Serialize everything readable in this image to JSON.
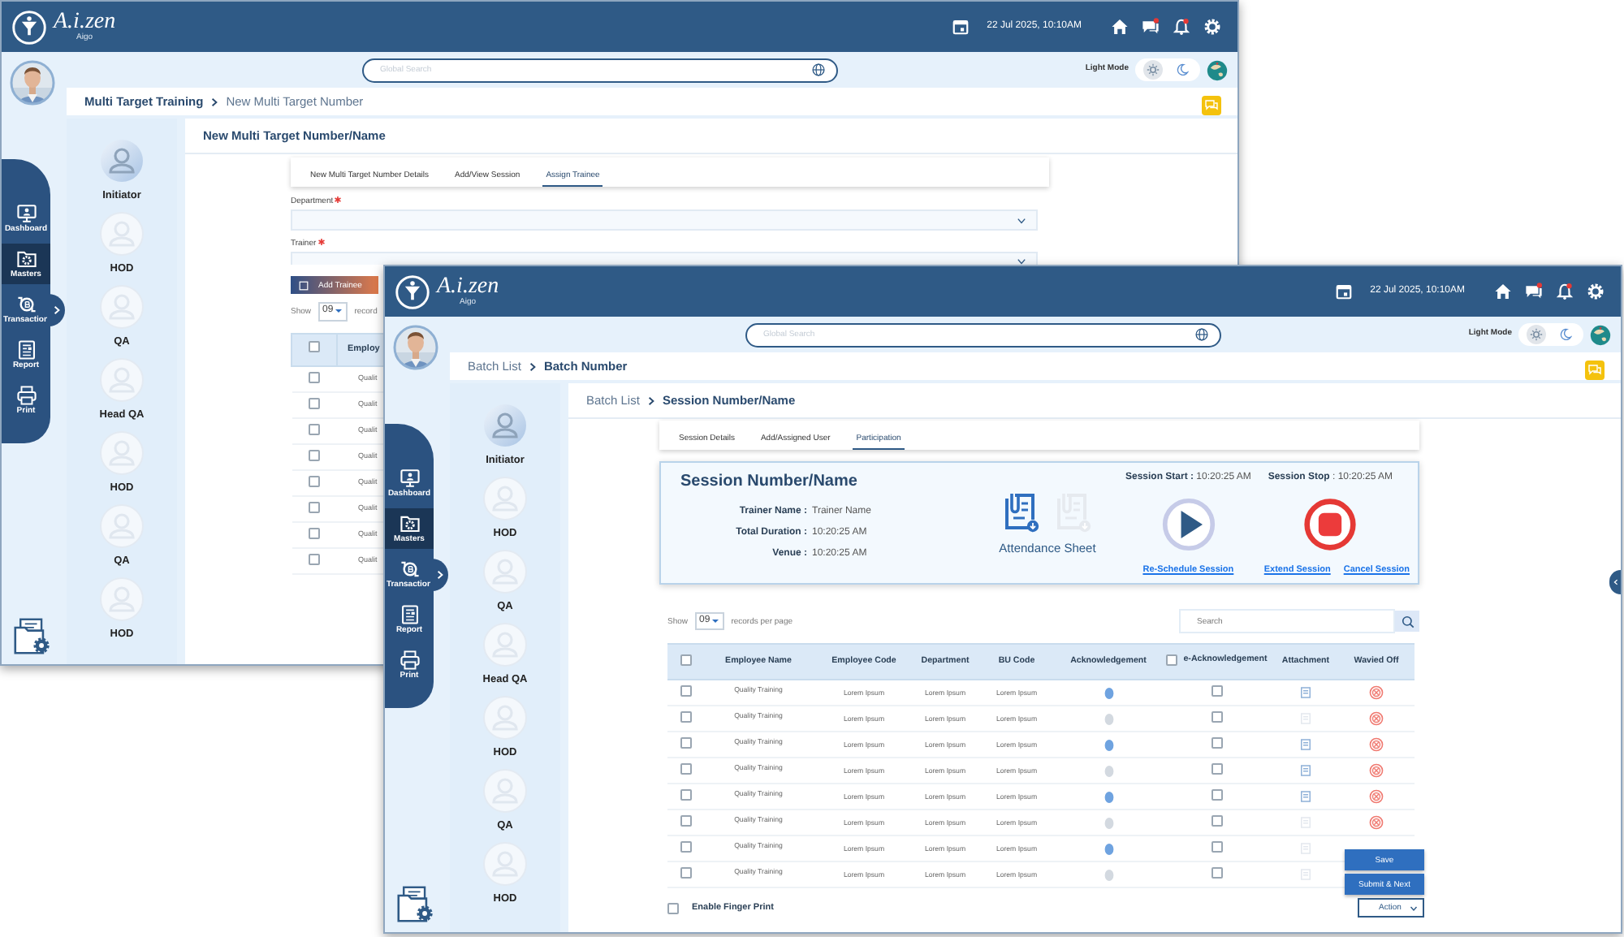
{
  "back_window": {
    "header": {
      "logo": "A.i.zen",
      "logo_sub": "Aigo",
      "datetime": "22 Jul 2025, 10:10AM",
      "chat_unread": true,
      "bell_unread": true
    },
    "search": {
      "placeholder": "Global Search"
    },
    "theme": {
      "label": "Light Mode",
      "dark": false
    },
    "breadcrumb": [
      {
        "label": "Multi Target Training",
        "strong": true
      },
      {
        "label": "New Multi Target  Number",
        "strong": false
      }
    ],
    "nav": [
      {
        "label": "Dashboard",
        "selected": false
      },
      {
        "label": "Masters",
        "selected": true
      },
      {
        "label": "Transaction",
        "selected": false
      },
      {
        "label": "Report",
        "selected": false
      },
      {
        "label": "Print",
        "selected": false
      }
    ],
    "workflow": [
      {
        "label": "Initiator",
        "active": true
      },
      {
        "label": "HOD",
        "active": false
      },
      {
        "label": "QA",
        "active": false
      },
      {
        "label": "Head QA",
        "active": false
      },
      {
        "label": "HOD",
        "active": false
      },
      {
        "label": "QA",
        "active": false
      },
      {
        "label": "HOD",
        "active": false
      }
    ],
    "page_title": [
      {
        "label": "New Multi Target  Number/Name",
        "strong": true
      }
    ],
    "tabs": [
      {
        "label": "New Multi Target Number Details",
        "selected": false
      },
      {
        "label": "Add/View Session",
        "selected": false
      },
      {
        "label": "Assign Trainee",
        "selected": true
      }
    ],
    "fields": [
      {
        "label": "Department",
        "required": true
      },
      {
        "label": "Trainer",
        "required": true
      }
    ],
    "add_button": "Add Trainee",
    "page_size": {
      "prefix": "Show",
      "value": "09",
      "suffix": "record"
    },
    "table": {
      "select_all": false,
      "column_1": "Employ",
      "rows": [
        {
          "checked": false,
          "column_1": "Qualit"
        },
        {
          "checked": false,
          "column_1": "Qualit"
        },
        {
          "checked": false,
          "column_1": "Qualit"
        },
        {
          "checked": false,
          "column_1": "Qualit"
        },
        {
          "checked": false,
          "column_1": "Qualit"
        },
        {
          "checked": false,
          "column_1": "Qualit"
        },
        {
          "checked": false,
          "column_1": "Qualit"
        },
        {
          "checked": false,
          "column_1": "Qualit"
        }
      ]
    }
  },
  "front_window": {
    "header": {
      "logo": "A.i.zen",
      "logo_sub": "Aigo",
      "datetime": "22 Jul 2025, 10:10AM",
      "chat_unread": true,
      "bell_unread": true
    },
    "search": {
      "placeholder": "Global Search"
    },
    "theme": {
      "label": "Light Mode",
      "dark": false
    },
    "breadcrumb": [
      {
        "label": "Batch List",
        "strong": false
      },
      {
        "label": "Batch  Number",
        "strong": true
      }
    ],
    "nav": [
      {
        "label": "Dashboard",
        "selected": false
      },
      {
        "label": "Masters",
        "selected": true
      },
      {
        "label": "Transaction",
        "selected": false
      },
      {
        "label": "Report",
        "selected": false
      },
      {
        "label": "Print",
        "selected": false
      }
    ],
    "workflow": [
      {
        "label": "Initiator",
        "active": true
      },
      {
        "label": "HOD",
        "active": false
      },
      {
        "label": "QA",
        "active": false
      },
      {
        "label": "Head QA",
        "active": false
      },
      {
        "label": "HOD",
        "active": false
      },
      {
        "label": "QA",
        "active": false
      },
      {
        "label": "HOD",
        "active": false
      }
    ],
    "page_title": [
      {
        "label": "Batch List",
        "strong": false
      },
      {
        "label": "Session Number/Name",
        "strong": true
      }
    ],
    "tabs": [
      {
        "label": "Session Details",
        "selected": false
      },
      {
        "label": "Add/Assigned User",
        "selected": false
      },
      {
        "label": "Participation",
        "selected": true
      }
    ],
    "session": {
      "title": "Session Number/Name",
      "details": [
        {
          "label": "Trainer Name :",
          "value": "Trainer Name"
        },
        {
          "label": "Total Duration :",
          "value": "10:20:25 AM"
        },
        {
          "label": "Venue :",
          "value": "10:20:25 AM"
        }
      ],
      "attendance": {
        "label": "Attendance Sheet",
        "download_enabled": true,
        "upload_enabled": false
      },
      "start": {
        "label": "Session Start :",
        "value": "10:20:25 AM",
        "link": "Re-Schedule Session"
      },
      "stop": {
        "label": "Session Stop",
        "value": ": 10:20:25 AM",
        "links": [
          "Extend Session",
          "Cancel Session"
        ]
      }
    },
    "page_size": {
      "prefix": "Show",
      "value": "09",
      "suffix": "records per page"
    },
    "table_search": {
      "placeholder": "Search"
    },
    "table": {
      "select_all": false,
      "e_ack_all": false,
      "columns": [
        "Employee Name",
        "Employee Code",
        "Department",
        "BU Code",
        "Acknowledgement",
        "e-Acknowledgement",
        "Attachment",
        "Wavied Off"
      ],
      "rows": [
        {
          "checked": false,
          "employee_name": "Quality Training",
          "employee_code": "Lorem Ipsum",
          "department": "Lorem Ipsum",
          "bu_code": "Lorem Ipsum",
          "acknowledged": true,
          "e_acknowledged": false,
          "attachment": true,
          "waive_icon": true
        },
        {
          "checked": false,
          "employee_name": "Quality Training",
          "employee_code": "Lorem Ipsum",
          "department": "Lorem Ipsum",
          "bu_code": "Lorem Ipsum",
          "acknowledged": false,
          "e_acknowledged": false,
          "attachment": false,
          "waive_icon": true
        },
        {
          "checked": false,
          "employee_name": "Quality Training",
          "employee_code": "Lorem Ipsum",
          "department": "Lorem Ipsum",
          "bu_code": "Lorem Ipsum",
          "acknowledged": true,
          "e_acknowledged": false,
          "attachment": true,
          "waive_icon": true
        },
        {
          "checked": false,
          "employee_name": "Quality Training",
          "employee_code": "Lorem Ipsum",
          "department": "Lorem Ipsum",
          "bu_code": "Lorem Ipsum",
          "acknowledged": false,
          "e_acknowledged": false,
          "attachment": true,
          "waive_icon": true
        },
        {
          "checked": false,
          "employee_name": "Quality Training",
          "employee_code": "Lorem Ipsum",
          "department": "Lorem Ipsum",
          "bu_code": "Lorem Ipsum",
          "acknowledged": true,
          "e_acknowledged": false,
          "attachment": true,
          "waive_icon": true
        },
        {
          "checked": false,
          "employee_name": "Quality Training",
          "employee_code": "Lorem Ipsum",
          "department": "Lorem Ipsum",
          "bu_code": "Lorem Ipsum",
          "acknowledged": false,
          "e_acknowledged": false,
          "attachment": false,
          "waive_icon": true
        },
        {
          "checked": false,
          "employee_name": "Quality Training",
          "employee_code": "Lorem Ipsum",
          "department": "Lorem Ipsum",
          "bu_code": "Lorem Ipsum",
          "acknowledged": true,
          "e_acknowledged": false,
          "attachment": false
        },
        {
          "checked": false,
          "employee_name": "Quality Training",
          "employee_code": "Lorem Ipsum",
          "department": "Lorem Ipsum",
          "bu_code": "Lorem Ipsum",
          "acknowledged": false,
          "e_acknowledged": false,
          "attachment": false
        }
      ]
    },
    "finger_print": {
      "label": "Enable Finger Print",
      "checked": false
    },
    "buttons": [
      "Save",
      "Submit & Next"
    ],
    "action": "Action"
  }
}
